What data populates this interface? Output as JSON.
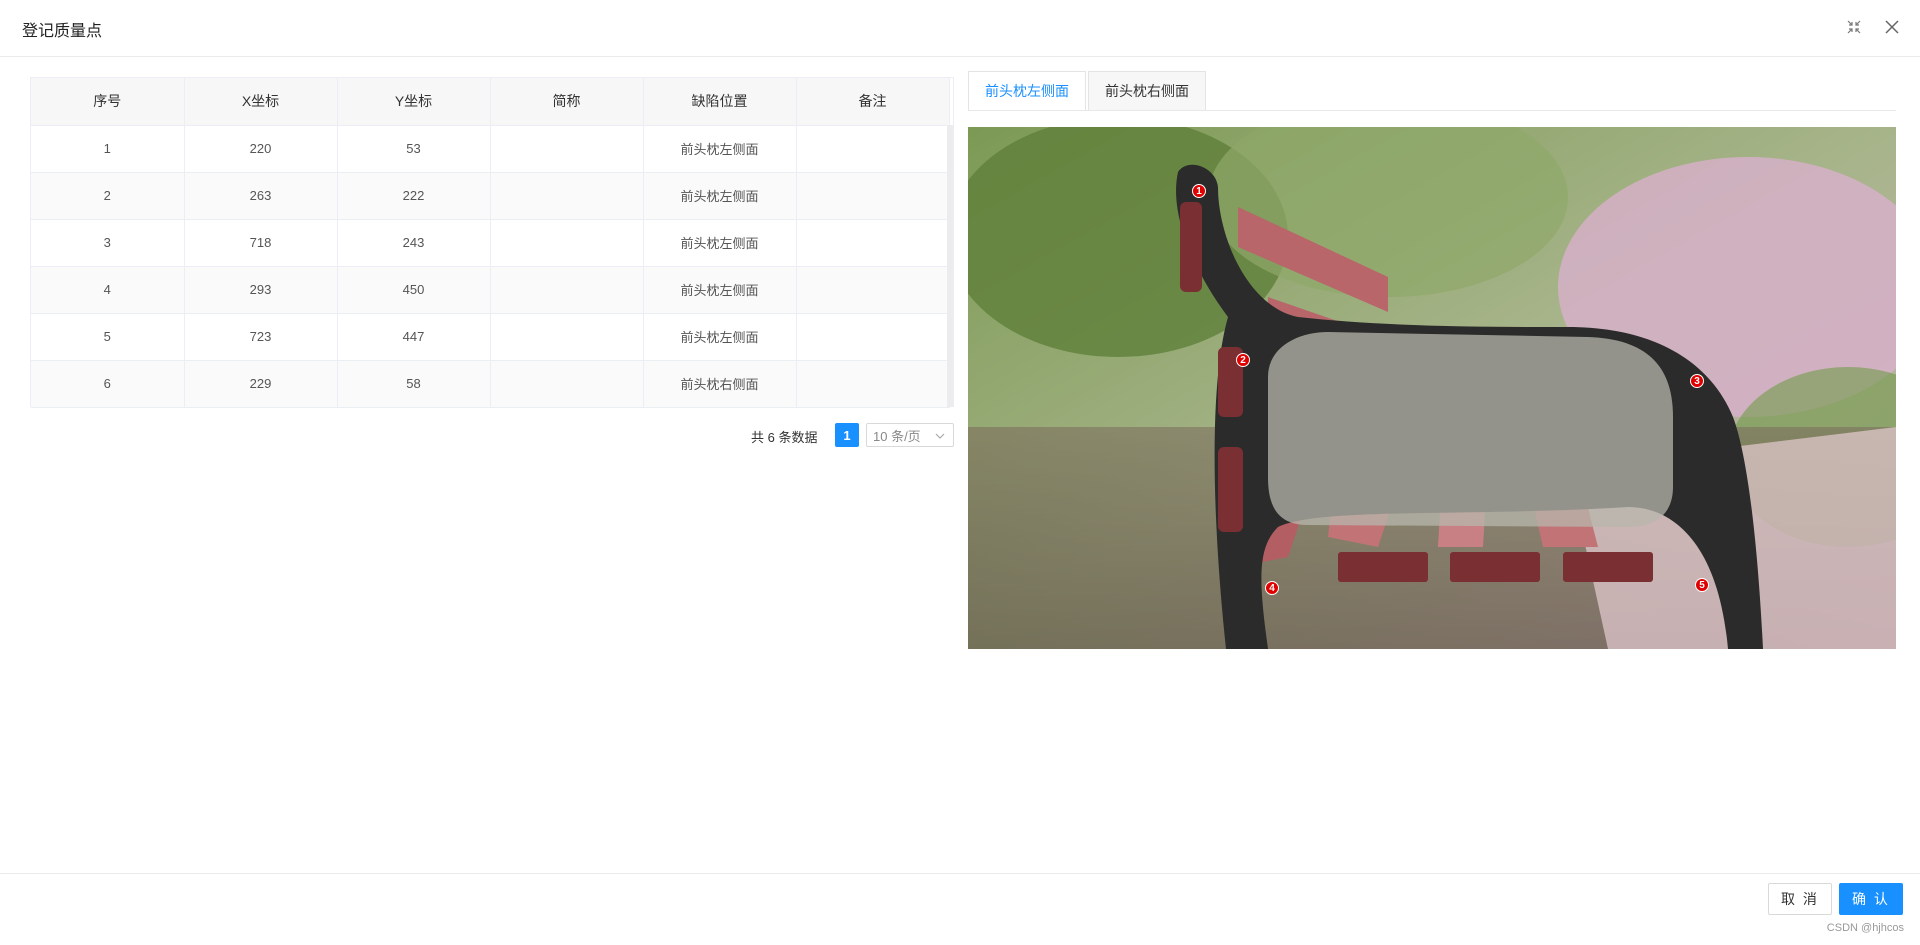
{
  "dialog": {
    "title": "登记质量点",
    "header_icons": [
      "compress-icon",
      "close-icon"
    ]
  },
  "table": {
    "columns": [
      "序号",
      "X坐标",
      "Y坐标",
      "简称",
      "缺陷位置",
      "备注"
    ],
    "rows": [
      [
        "1",
        "220",
        "53",
        "",
        "前头枕左侧面",
        ""
      ],
      [
        "2",
        "263",
        "222",
        "",
        "前头枕左侧面",
        ""
      ],
      [
        "3",
        "718",
        "243",
        "",
        "前头枕左侧面",
        ""
      ],
      [
        "4",
        "293",
        "450",
        "",
        "前头枕左侧面",
        ""
      ],
      [
        "5",
        "723",
        "447",
        "",
        "前头枕左侧面",
        ""
      ],
      [
        "6",
        "229",
        "58",
        "",
        "前头枕右侧面",
        ""
      ]
    ]
  },
  "pagination": {
    "total_text": "共 6 条数据",
    "current_page": "1",
    "page_size": "10 条/页"
  },
  "tabs": [
    {
      "label": "前头枕左侧面",
      "active": true
    },
    {
      "label": "前头枕右侧面",
      "active": false
    }
  ],
  "photo": {
    "markers": [
      "1",
      "2",
      "3",
      "4",
      "5"
    ]
  },
  "footer": {
    "cancel_label": "取 消",
    "ok_label": "确 认",
    "watermark": "CSDN @hjhcos"
  },
  "colors": {
    "primary": "#1890ff",
    "marker": "#e00000"
  }
}
